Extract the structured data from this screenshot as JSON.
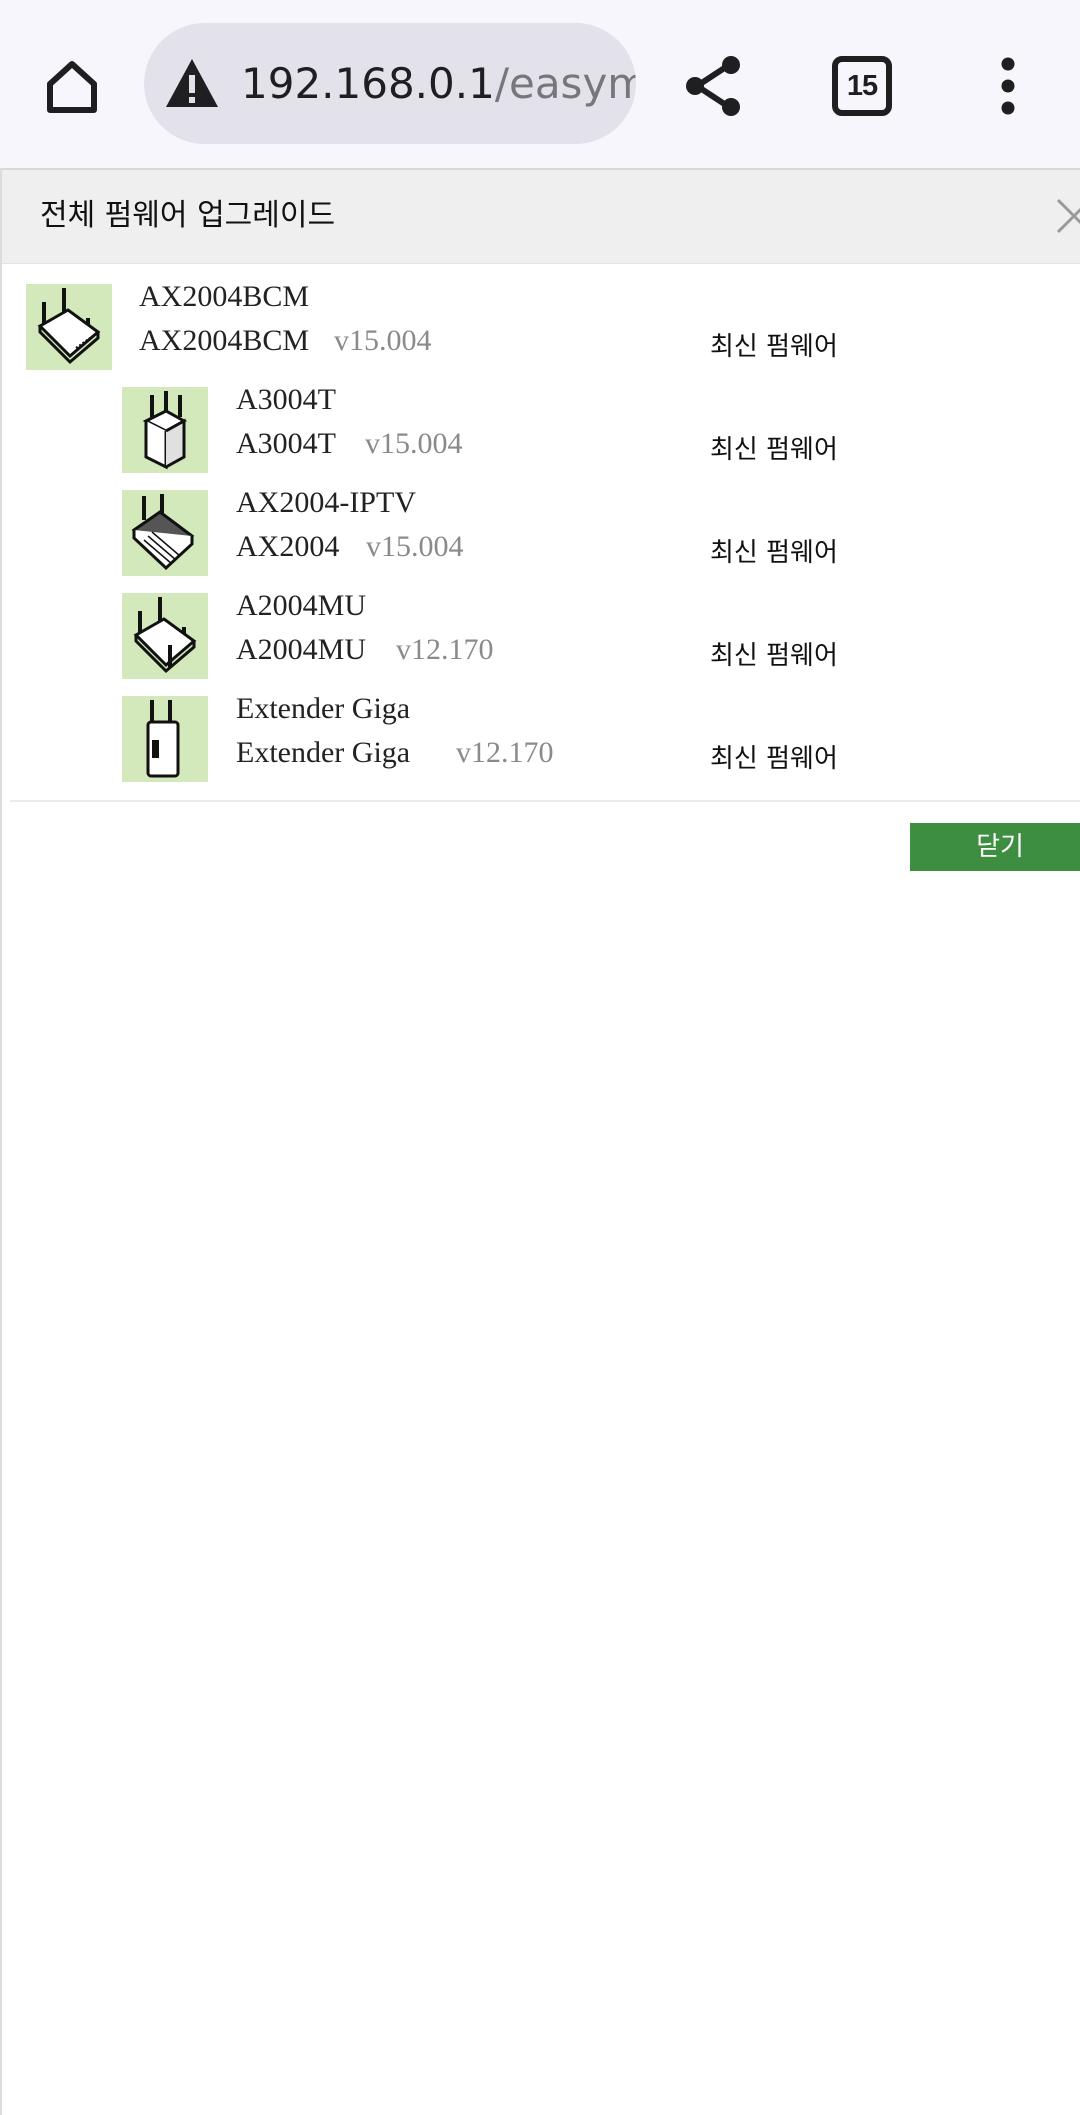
{
  "browser": {
    "url_host": "192.168.0.1",
    "url_path": "/easymesh",
    "tab_count": "15",
    "icons": {
      "home": "home-icon",
      "warning": "warning-icon",
      "share": "share-icon",
      "menu": "more-vert-icon"
    }
  },
  "dialog": {
    "title": "전체 펌웨어 업그레이드",
    "close_button_label": "닫기",
    "devices": [
      {
        "name": "AX2004BCM",
        "model": "AX2004BCM",
        "version": "v15.004",
        "status": "최신 펌웨어",
        "icon": "router-4-antenna-icon"
      },
      {
        "name": "A3004T",
        "model": "A3004T",
        "version": "v15.004",
        "status": "최신 펌웨어",
        "icon": "router-cube-icon"
      },
      {
        "name": "AX2004-IPTV",
        "model": "AX2004",
        "version": "v15.004",
        "status": "최신 펌웨어",
        "icon": "router-iptv-icon"
      },
      {
        "name": "A2004MU",
        "model": "A2004MU",
        "version": "v12.170",
        "status": "최신 펌웨어",
        "icon": "router-4-antenna-icon"
      },
      {
        "name": "Extender Giga",
        "model": "Extender Giga",
        "version": "v12.170",
        "status": "최신 펌웨어",
        "icon": "extender-icon"
      }
    ]
  },
  "colors": {
    "toolbar_bg": "#f7f6fc",
    "url_bar_bg": "#e3e2ea",
    "header_bg": "#efefef",
    "icon_bg": "#d3e8bb",
    "close_button_bg": "#3e8e41"
  }
}
